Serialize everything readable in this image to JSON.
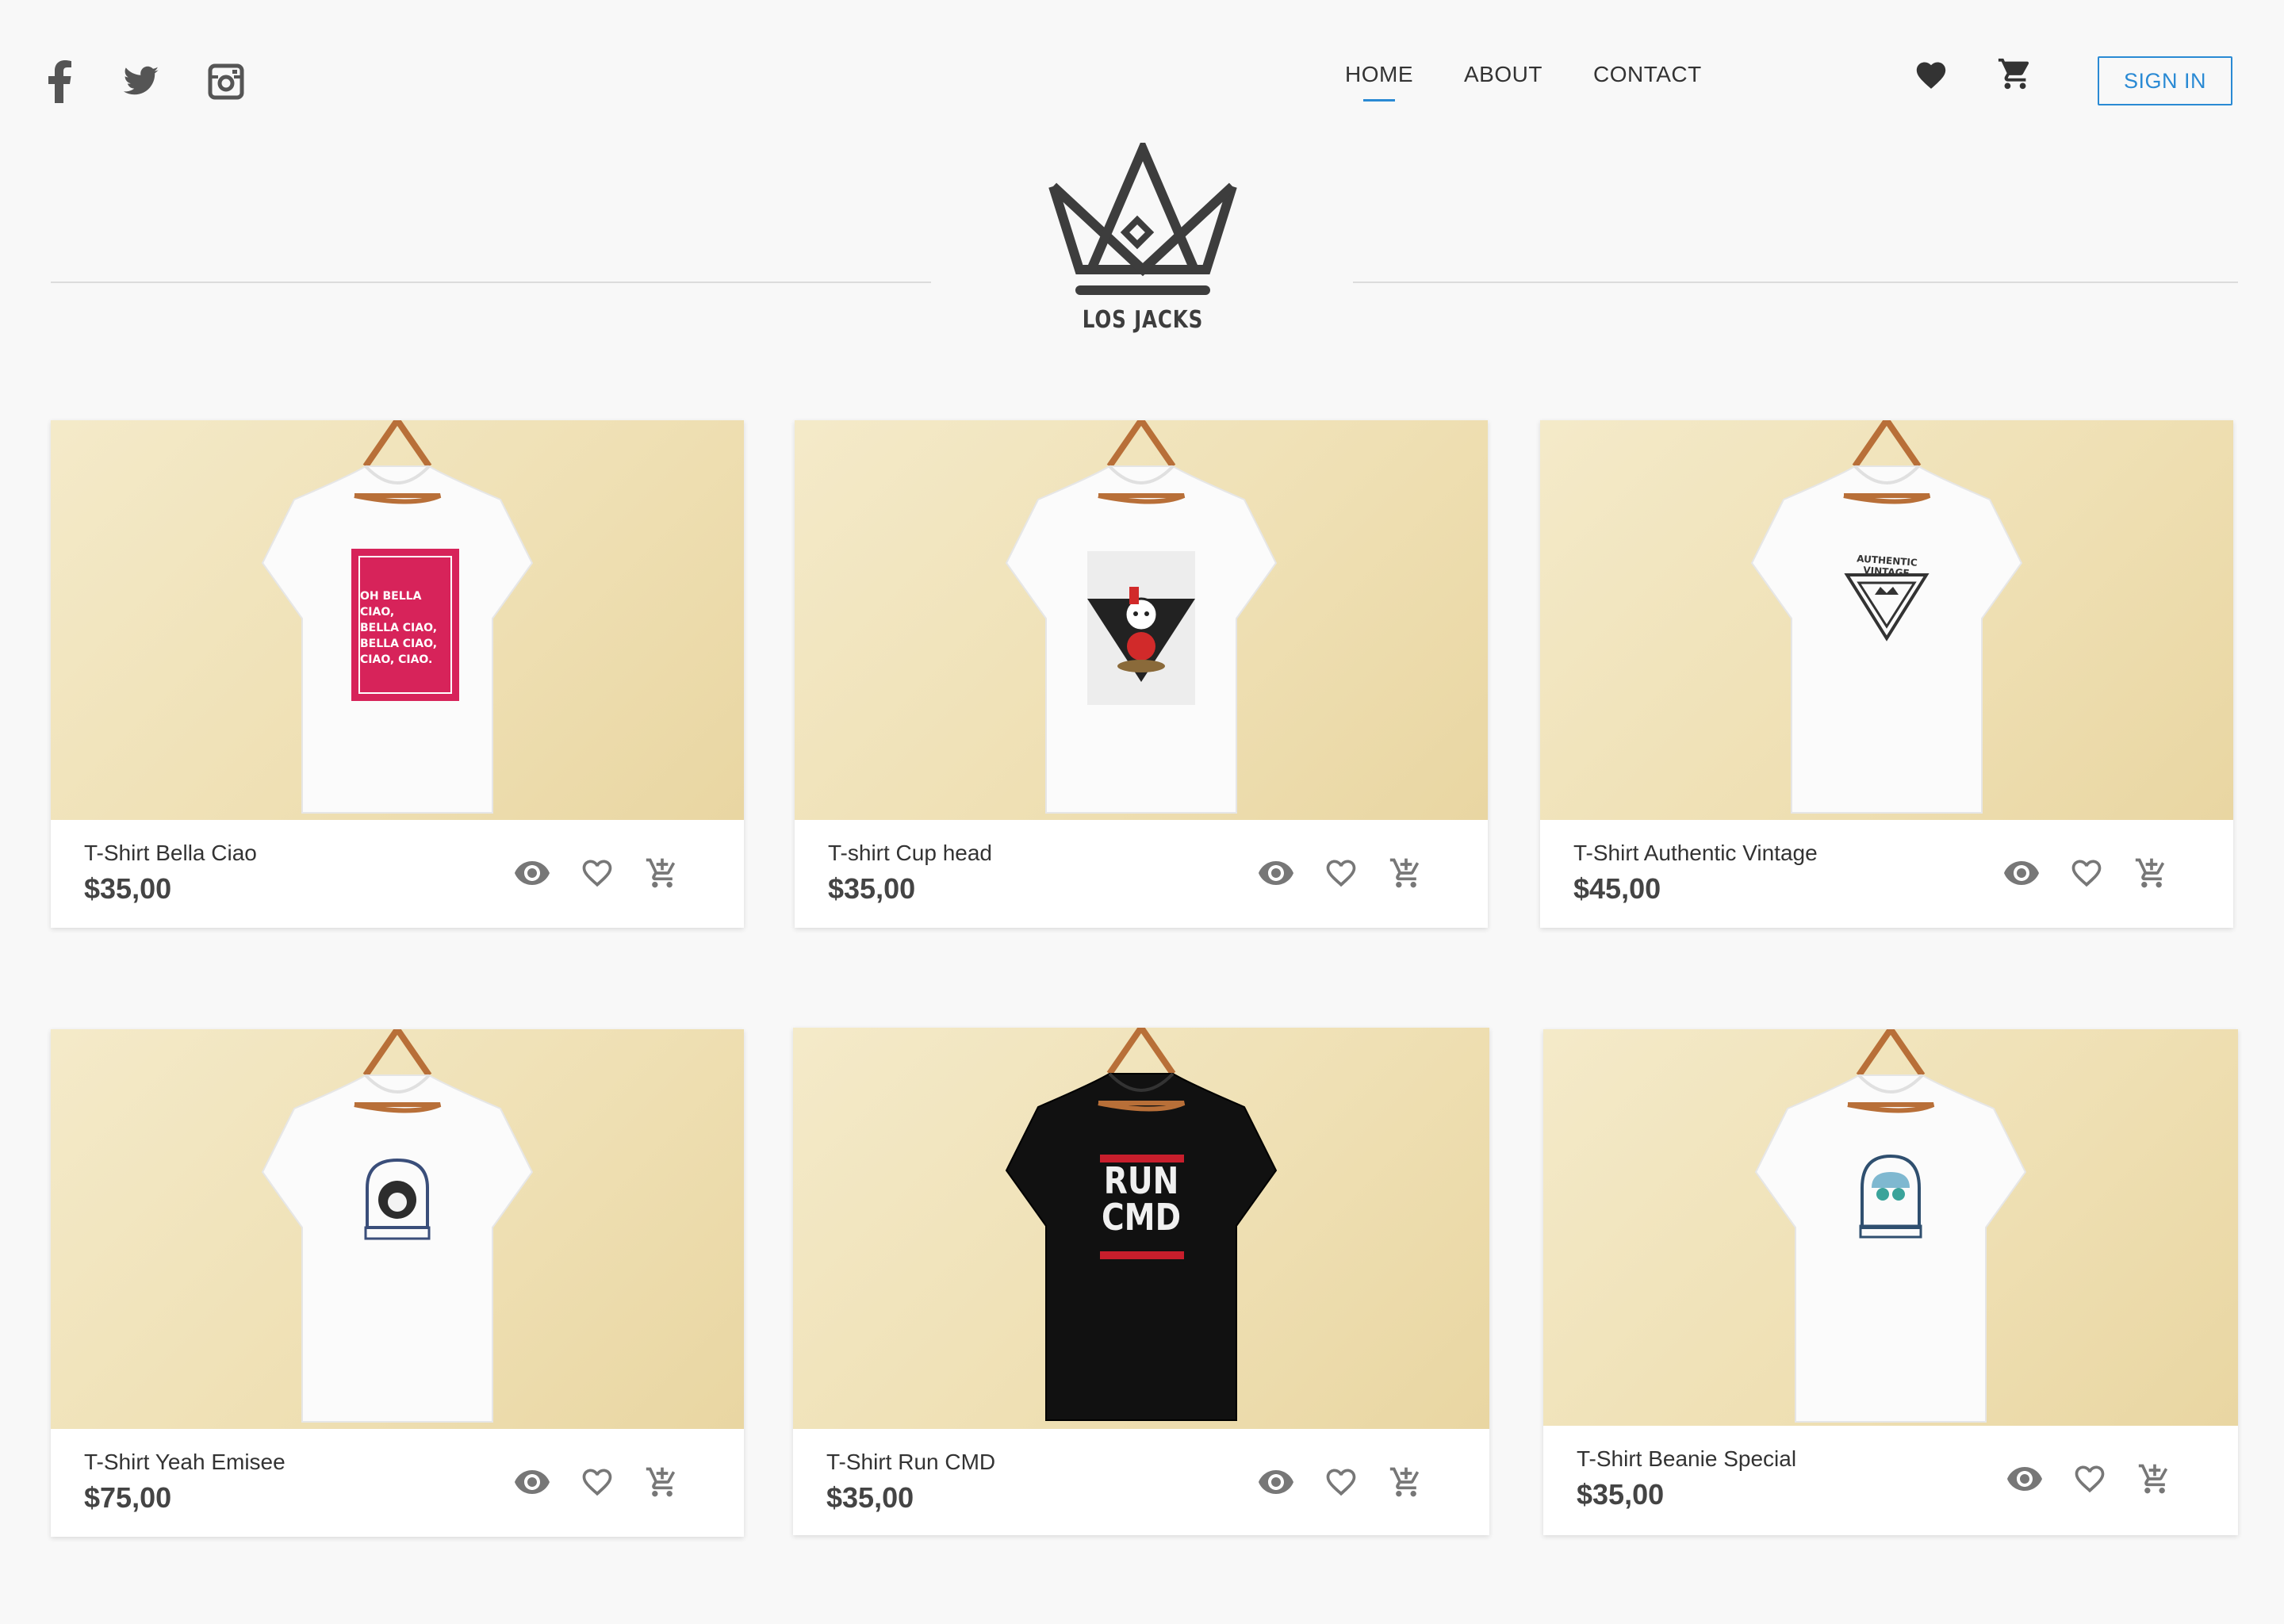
{
  "header": {
    "social": [
      "facebook-icon",
      "twitter-icon",
      "instagram-icon"
    ],
    "nav": [
      {
        "label": "HOME",
        "active": true
      },
      {
        "label": "ABOUT",
        "active": false
      },
      {
        "label": "CONTACT",
        "active": false
      }
    ],
    "actions": [
      "heart-icon",
      "cart-icon"
    ],
    "signin_label": "SIGN IN"
  },
  "brand": {
    "name": "LOS JACKS",
    "colors": {
      "accent": "#2a8ad4",
      "text": "#333333",
      "background": "#f8f8f8",
      "card_bg": "#f1e4bd"
    }
  },
  "products": [
    {
      "name": "T-Shirt Bella Ciao",
      "price": "$35,00",
      "shirt_color": "white",
      "print_text": [
        "OH BELLA CIAO,",
        "BELLA CIAO,",
        "BELLA CIAO,",
        "CIAO, CIAO."
      ]
    },
    {
      "name": "T-shirt Cup head",
      "price": "$35,00",
      "shirt_color": "white"
    },
    {
      "name": "T-Shirt Authentic Vintage",
      "price": "$45,00",
      "shirt_color": "white",
      "print_text": [
        "AUTHENTIC VINTAGE"
      ]
    },
    {
      "name": "T-Shirt Yeah Emisee",
      "price": "$75,00",
      "shirt_color": "white"
    },
    {
      "name": "T-Shirt Run CMD",
      "price": "$35,00",
      "shirt_color": "black",
      "print_text": [
        "RUN",
        "CMD"
      ]
    },
    {
      "name": "T-Shirt Beanie Special",
      "price": "$35,00",
      "shirt_color": "white"
    }
  ],
  "card_actions": [
    "eye-icon",
    "heart-outline-icon",
    "add-to-cart-icon"
  ]
}
